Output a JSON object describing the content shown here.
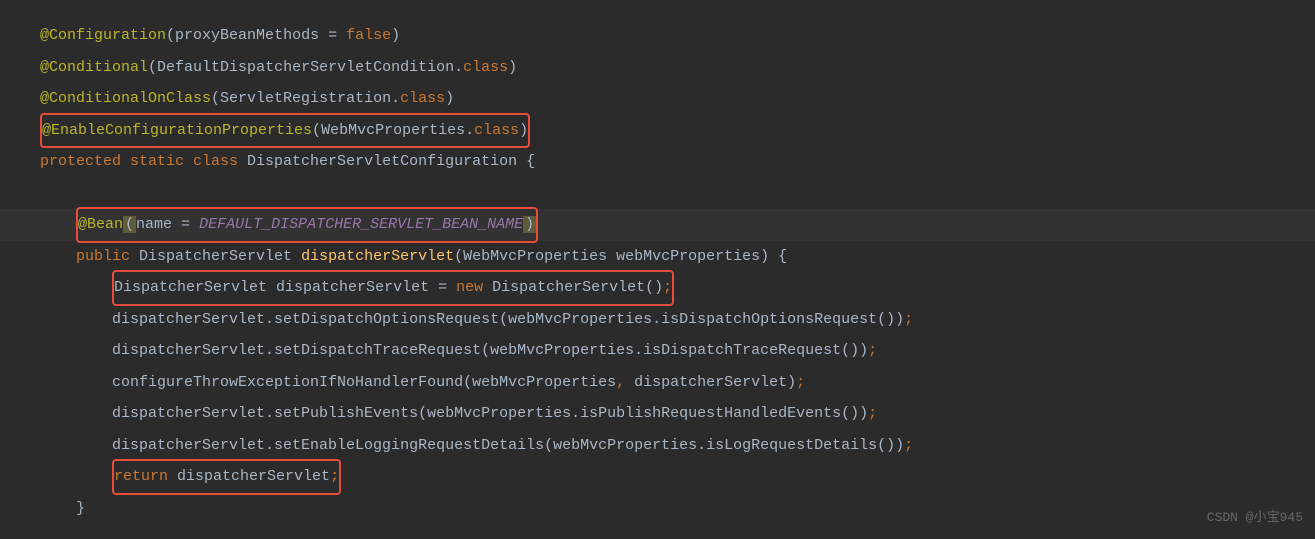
{
  "code": {
    "line1": {
      "annotation": "@Configuration",
      "paren_open": "(",
      "param": "proxyBeanMethods = ",
      "value": "false",
      "paren_close": ")"
    },
    "line2": {
      "annotation": "@Conditional",
      "paren_open": "(",
      "param": "DefaultDispatcherServletCondition",
      "dot": ".",
      "keyword": "class",
      "paren_close": ")"
    },
    "line3": {
      "annotation": "@ConditionalOnClass",
      "paren_open": "(",
      "param": "ServletRegistration",
      "dot": ".",
      "keyword": "class",
      "paren_close": ")"
    },
    "line4": {
      "annotation": "@EnableConfigurationProperties",
      "paren_open": "(",
      "param": "WebMvcProperties",
      "dot": ".",
      "keyword": "class",
      "paren_close": ")"
    },
    "line5": {
      "modifiers": "protected static class ",
      "classname": "DispatcherServletConfiguration ",
      "brace": "{"
    },
    "line6": {
      "annotation": "@Bean",
      "paren_open": "(",
      "param_name": "name = ",
      "constant": "DEFAULT_DISPATCHER_SERVLET_BEAN_NAME",
      "paren_close": ")"
    },
    "line7": {
      "modifier": "public ",
      "return_type": "DispatcherServlet ",
      "method_name": "dispatcherServlet",
      "params": "(WebMvcProperties webMvcProperties) {"
    },
    "line8": {
      "type": "DispatcherServlet ",
      "var": "dispatcherServlet = ",
      "new_kw": "new ",
      "ctor": "DispatcherServlet()",
      "semi": ";"
    },
    "line9": {
      "text": "dispatcherServlet.setDispatchOptionsRequest(webMvcProperties.isDispatchOptionsRequest())",
      "semi": ";"
    },
    "line10": {
      "text": "dispatcherServlet.setDispatchTraceRequest(webMvcProperties.isDispatchTraceRequest())",
      "semi": ";"
    },
    "line11": {
      "text": "configureThrowExceptionIfNoHandlerFound(webMvcProperties",
      "comma": ", ",
      "text2": "dispatcherServlet)",
      "semi": ";"
    },
    "line12": {
      "text": "dispatcherServlet.setPublishEvents(webMvcProperties.isPublishRequestHandledEvents())",
      "semi": ";"
    },
    "line13": {
      "text": "dispatcherServlet.setEnableLoggingRequestDetails(webMvcProperties.isLogRequestDetails())",
      "semi": ";"
    },
    "line14": {
      "return_kw": "return ",
      "var": "dispatcherServlet",
      "semi": ";"
    },
    "line15": {
      "brace": "}"
    }
  },
  "watermark": "CSDN @小宝945"
}
